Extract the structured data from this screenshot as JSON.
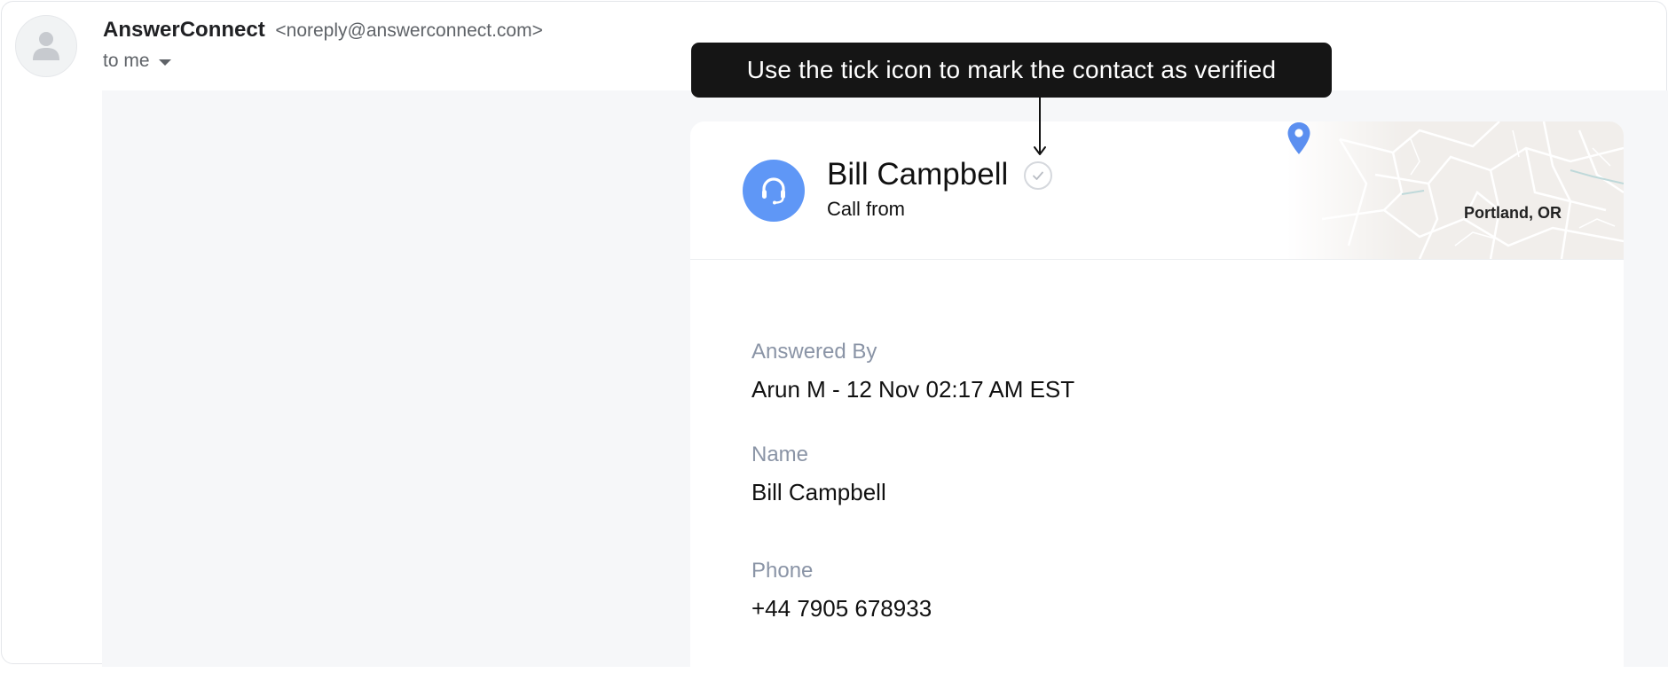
{
  "email": {
    "sender_name": "AnswerConnect",
    "sender_email": "<noreply@answerconnect.com>",
    "recipient": "to me"
  },
  "tooltip": {
    "text": "Use the tick icon to mark the contact as verified"
  },
  "card": {
    "caller_name": "Bill Campbell",
    "call_type": "Call from",
    "location": "Portland, OR",
    "fields": [
      {
        "label": "Answered By",
        "value": "Arun M - 12 Nov 02:17 AM EST"
      },
      {
        "label": "Name",
        "value": "Bill Campbell"
      },
      {
        "label": "Phone",
        "value": "+44 7905 678933"
      }
    ]
  },
  "icons": {
    "sender_avatar": "person-icon",
    "agent": "headset-icon",
    "verify": "check-circle-icon",
    "location": "map-pin-icon",
    "recipient_toggle": "caret-down-icon"
  },
  "colors": {
    "agent_icon_bg": "#5f97f6",
    "tooltip_bg": "#151515",
    "field_label": "#8a94a6",
    "map_pin": "#5b8ff0"
  }
}
